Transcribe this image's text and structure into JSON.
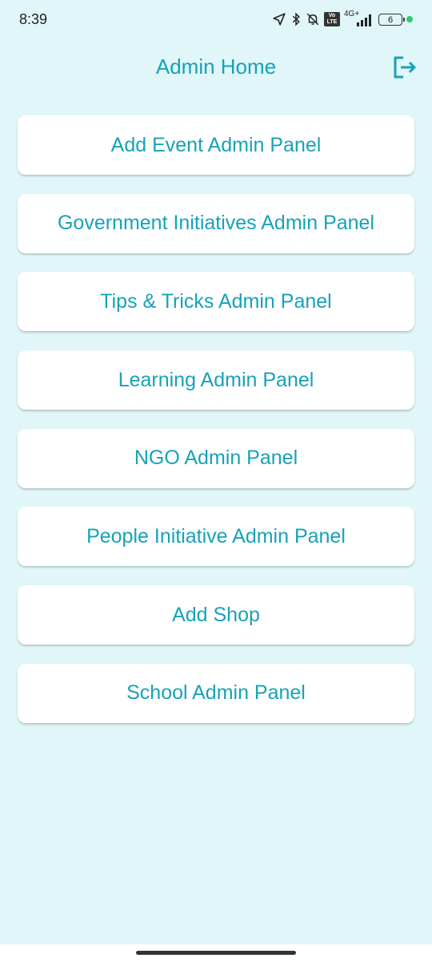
{
  "status_bar": {
    "time": "8:39",
    "network_label": "4G+",
    "volte_label": "Vo LTE",
    "battery_level": "6",
    "icons": [
      "location-arrow-icon",
      "bluetooth-icon",
      "bell-off-icon",
      "volte-icon",
      "signal-icon",
      "battery-icon"
    ]
  },
  "header": {
    "title": "Admin Home",
    "logout_icon": "logout-icon"
  },
  "panels": [
    "Add Event Admin Panel",
    "Government Initiatives Admin Panel",
    "Tips & Tricks Admin Panel",
    "Learning Admin Panel",
    "NGO Admin Panel",
    "People Initiative Admin Panel",
    "Add Shop",
    "School Admin Panel"
  ],
  "colors": {
    "accent": "#17a2b8",
    "background": "#e0f6f8",
    "card": "#ffffff"
  }
}
